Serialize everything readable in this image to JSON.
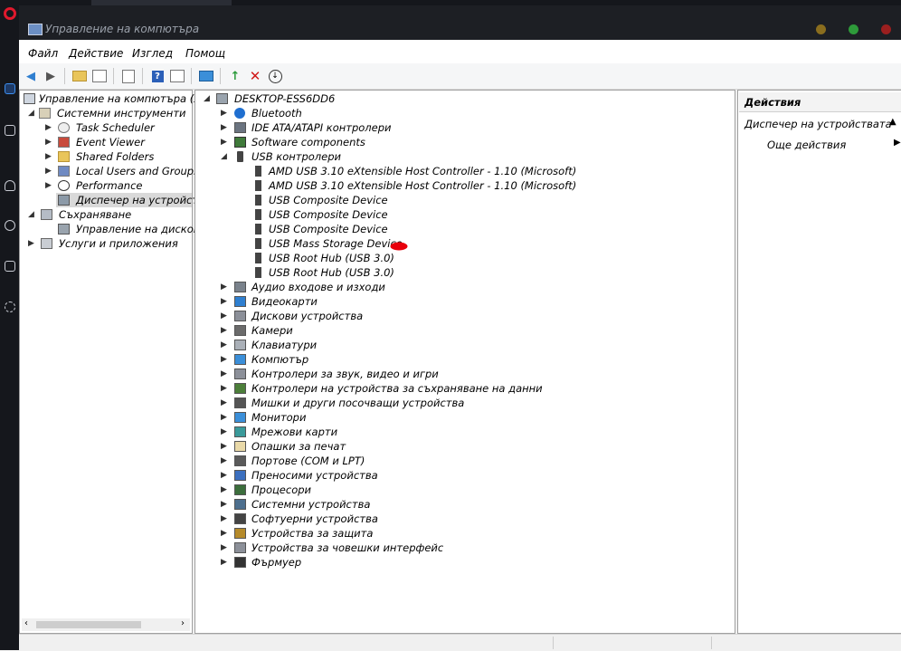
{
  "colors": {
    "opera_red": "#e0192d",
    "accent_blue": "#3d8ff0",
    "window_dark": "#1d1f24",
    "mark_red": "#e8000c"
  },
  "window": {
    "title": "Управление на компютъра"
  },
  "menu": [
    "Файл",
    "Действие",
    "Изглед",
    "Помощ"
  ],
  "toolbar_icons": [
    "back-arrow-icon",
    "forward-arrow-icon",
    "folder-up-icon",
    "show-hide-tree-icon",
    "properties-icon",
    "help-icon",
    "help-pane-icon",
    "monitor-icon",
    "update-driver-icon",
    "uninstall-icon",
    "scan-hardware-icon"
  ],
  "left_tree": {
    "root": "Управление на компютъра (л",
    "system_tools": "Системни инструменти",
    "task_scheduler": "Task Scheduler",
    "event_viewer": "Event Viewer",
    "shared_folders": "Shared Folders",
    "local_users": "Local Users and Groups",
    "performance": "Performance",
    "device_manager": "Диспечер на устройства",
    "storage": "Съхраняване",
    "disk_mgmt": "Управление на дискове",
    "services": "Услуги и приложения"
  },
  "device_tree": {
    "computer": "DESKTOP-ESS6DD6",
    "bluetooth": "Bluetooth",
    "ide": "IDE ATA/ATAPI контролери",
    "software_components": "Software components",
    "usb_controllers": "USB контролери",
    "usb_children": [
      "AMD USB 3.10 eXtensible Host Controller - 1.10 (Microsoft)",
      "AMD USB 3.10 eXtensible Host Controller - 1.10 (Microsoft)",
      "USB Composite Device",
      "USB Composite Device",
      "USB Composite Device",
      "USB Mass Storage Device",
      "USB Root Hub (USB 3.0)",
      "USB Root Hub (USB 3.0)"
    ],
    "categories": [
      "Аудио входове и изходи",
      "Видеокарти",
      "Дискови устройства",
      "Камери",
      "Клавиатури",
      "Компютър",
      "Контролери за звук, видео и игри",
      "Контролери на устройства за съхраняване на данни",
      "Мишки и други посочващи устройства",
      "Монитори",
      "Мрежови карти",
      "Опашки за печат",
      "Портове (COM и LPT)",
      "Преносими устройства",
      "Процесори",
      "Системни устройства",
      "Софтуерни устройства",
      "Устройства за защита",
      "Устройства за човешки интерфейс",
      "Фърмуер"
    ],
    "category_icons": [
      "speaker-icon",
      "display-adapter-icon",
      "disk-drive-icon",
      "camera-icon",
      "keyboard-icon",
      "computer-icon",
      "sound-icon",
      "storage-controller-icon",
      "mouse-icon",
      "monitor-icon",
      "network-adapter-icon",
      "print-queue-icon",
      "port-icon",
      "portable-device-icon",
      "processor-icon",
      "system-device-icon",
      "software-device-icon",
      "security-device-icon",
      "hid-icon",
      "firmware-icon"
    ]
  },
  "actions": {
    "header": "Действия",
    "section": "Диспечер на устройствата",
    "more": "Още действия"
  }
}
